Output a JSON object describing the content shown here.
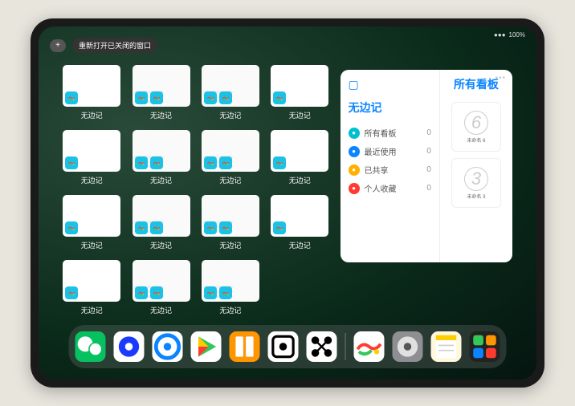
{
  "status": {
    "battery": "100%",
    "signal": "●●●"
  },
  "topbar": {
    "plus": "+",
    "recent": "重新打开已关闭的窗口"
  },
  "window_label": "无边记",
  "window_grid": {
    "rows": 3,
    "cols": 4,
    "extra_row_count": 3
  },
  "panel": {
    "title": "无边记",
    "right_title": "所有看板",
    "menu": [
      {
        "icon": "list",
        "color": "#00c0d0",
        "label": "所有看板",
        "count": "0"
      },
      {
        "icon": "clock",
        "color": "#0a84ff",
        "label": "最近使用",
        "count": "0"
      },
      {
        "icon": "share",
        "color": "#ffb000",
        "label": "已共享",
        "count": "0"
      },
      {
        "icon": "heart",
        "color": "#ff3b30",
        "label": "个人收藏",
        "count": "0"
      }
    ],
    "boards": [
      {
        "num": "6",
        "label": "未命名 6"
      },
      {
        "num": "3",
        "label": "未命名 3"
      }
    ]
  },
  "dock": {
    "left": [
      {
        "name": "wechat",
        "bg": "#07c160",
        "glyph": "wechat"
      },
      {
        "name": "quark",
        "bg": "#ffffff",
        "glyph": "quark"
      },
      {
        "name": "qqbrowser",
        "bg": "#ffffff",
        "glyph": "qqb"
      },
      {
        "name": "play",
        "bg": "#ffffff",
        "glyph": "play"
      },
      {
        "name": "books",
        "bg": "#ff9500",
        "glyph": "books"
      },
      {
        "name": "dice",
        "bg": "#ffffff",
        "glyph": "dice"
      },
      {
        "name": "connect",
        "bg": "#ffffff",
        "glyph": "connect"
      }
    ],
    "right": [
      {
        "name": "freeform",
        "bg": "#ffffff",
        "glyph": "freeform"
      },
      {
        "name": "settings",
        "bg": "#8e8e93",
        "glyph": "gear"
      },
      {
        "name": "notes",
        "bg": "#fff8dc",
        "glyph": "notes"
      },
      {
        "name": "apps",
        "bg": "#222",
        "glyph": "grid"
      }
    ]
  }
}
